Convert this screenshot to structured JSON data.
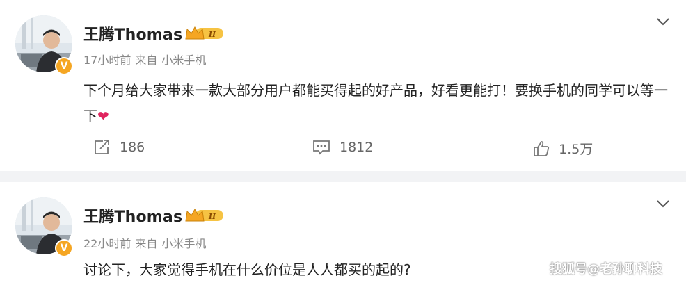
{
  "posts": [
    {
      "username": "王腾Thomas",
      "member_level": "II",
      "verified_badge": "V",
      "time": "17小时前",
      "source_prefix": "来自",
      "source": "小米手机",
      "text": "下个月给大家带来一款大部分用户都能买得起的好产品，好看更能打！要换手机的同学可以等一下",
      "emoji": "❤",
      "repost_count": "186",
      "comment_count": "1812",
      "like_count": "1.5万"
    },
    {
      "username": "王腾Thomas",
      "member_level": "II",
      "verified_badge": "V",
      "time": "22小时前",
      "source_prefix": "来自",
      "source": "小米手机",
      "text": "讨论下，大家觉得手机在什么价位是人人都买的起的?"
    }
  ],
  "watermark": "搜狐号@老孙聊科技",
  "colors": {
    "accent_orange": "#f5a623",
    "heart_red": "#e0245e",
    "divider": "#f2f3f5"
  }
}
